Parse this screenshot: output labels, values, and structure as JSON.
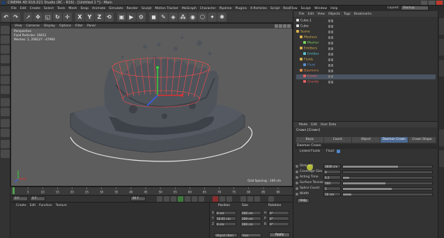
{
  "window": {
    "title": "CINEMA 4D R16.021 Studio (RC - R16) - [Untitled 1 *] - Main"
  },
  "menubar": {
    "items": [
      "File",
      "Edit",
      "Create",
      "Select",
      "Tools",
      "Mesh",
      "Snap",
      "Animate",
      "Simulate",
      "Render",
      "Sculpt",
      "Motion Tracker",
      "MoGraph",
      "Character",
      "Pipeline",
      "Plugins",
      "X-Particles",
      "Script",
      "RealFlow",
      "Sculpt",
      "Window",
      "Help"
    ]
  },
  "layout": {
    "label": "Layout:",
    "value": "Startup"
  },
  "toolbar": {
    "axis_x": "X",
    "axis_y": "Y",
    "axis_z": "Z"
  },
  "viewport": {
    "menu": [
      "View",
      "Cameras",
      "Display",
      "Options",
      "Filter",
      "Panel"
    ],
    "camera": "Perspective",
    "info_line1": "Fluid Particles: 19412",
    "info_line2": "Meshes: 1, 208127 - 47960",
    "grid_spacing": "Grid Spacing : 100 cm"
  },
  "timeline": {
    "start": "0 F",
    "end": "90 F",
    "current": "0 F",
    "frames": [
      "0",
      "5",
      "10",
      "15",
      "20",
      "25",
      "30",
      "35",
      "40",
      "45",
      "50",
      "55",
      "60",
      "65",
      "70",
      "75",
      "80",
      "85",
      "90"
    ]
  },
  "material_manager": {
    "menu": [
      "Create",
      "Edit",
      "Function",
      "Texture"
    ]
  },
  "coordinates": {
    "headers": {
      "position": "Position",
      "size": "Size",
      "rotation": "Rotation"
    },
    "rows": [
      {
        "axis": "X",
        "pos": "0 cm",
        "size": "200 cm",
        "rot_label": "H",
        "rot": "0°"
      },
      {
        "axis": "Y",
        "pos": "10.01 cm",
        "size": "200 cm",
        "rot_label": "P",
        "rot": "0°"
      },
      {
        "axis": "Z",
        "pos": "0 cm",
        "size": "200 cm",
        "rot_label": "B",
        "rot": "0°"
      }
    ],
    "mode": "Object (Rel)",
    "size_mode": "Size",
    "apply": "Apply"
  },
  "object_manager": {
    "menu": [
      "File",
      "Edit",
      "View",
      "Objects",
      "Tags",
      "Bookmarks"
    ],
    "objects": [
      {
        "name": "Cube.1",
        "color": "#d8d8d8",
        "indent": 0
      },
      {
        "name": "Cube",
        "color": "#d8d8d8",
        "indent": 0
      },
      {
        "name": "Scene",
        "color": "#d9b24a",
        "indent": 0
      },
      {
        "name": "Meshers",
        "color": "#d9b24a",
        "indent": 1
      },
      {
        "name": "Mesher",
        "color": "#7ad35a",
        "indent": 2
      },
      {
        "name": "Emitters",
        "color": "#d9b24a",
        "indent": 1
      },
      {
        "name": "Emitter",
        "color": "#5ac0d3",
        "indent": 2
      },
      {
        "name": "Fluids",
        "color": "#d9b24a",
        "indent": 1
      },
      {
        "name": "Fluid",
        "color": "#5a8fd3",
        "indent": 2
      },
      {
        "name": "Daemons",
        "color": "#d98a4a",
        "indent": 1
      },
      {
        "name": "Crown",
        "color": "#e06060",
        "indent": 2
      },
      {
        "name": "Gravity",
        "color": "#e06060",
        "indent": 2
      }
    ]
  },
  "attribute_manager": {
    "menu": [
      "Mode",
      "Edit",
      "User Data"
    ],
    "title": "Crown [Crown]",
    "tabs": [
      "Basic",
      "Coord.",
      "Object",
      "Daemon Crown",
      "Crown Shape"
    ],
    "active_tab": "Daemon Crown",
    "section": "Daemon Crown",
    "linked_label": "Linked Fluids",
    "linked_value": "Fluid",
    "params": [
      {
        "label": "Strength",
        "value": "3600 cm",
        "fill": 0.62
      },
      {
        "label": "Coverage Size",
        "value": "0",
        "fill": 0.0
      },
      {
        "label": "Acting Time",
        "value": "0.2",
        "fill": 0.07
      },
      {
        "label": "Surface Tension",
        "value": "500",
        "fill": 0.48
      },
      {
        "label": "Splice Count",
        "value": "5",
        "fill": 0.55
      },
      {
        "label": "Width",
        "value": "10 cm",
        "fill": 0.09
      }
    ],
    "help": "Help"
  },
  "colors": {
    "accent_tab": "#4d6a93",
    "mesh": "#4a5058",
    "force_field": "#ff4b4b"
  }
}
